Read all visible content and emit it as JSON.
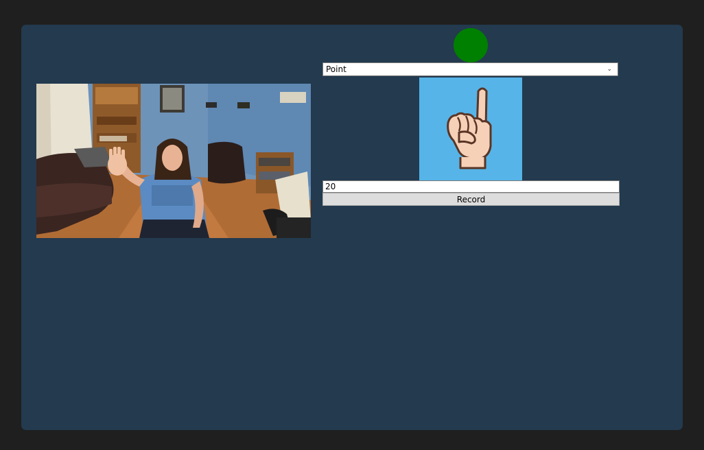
{
  "status": {
    "color": "#008000",
    "icon": "status-indicator-dot"
  },
  "gesture_select": {
    "selected": "Point",
    "dropdown_icon": "chevron-down-icon"
  },
  "gesture_image": {
    "icon": "pointing-finger-hand-icon",
    "background": "#56b4e8"
  },
  "count_input": {
    "value": "20"
  },
  "record_button": {
    "label": "Record"
  },
  "colors": {
    "window_background": "#233a4f",
    "app_frame": "#1f1f1f"
  }
}
